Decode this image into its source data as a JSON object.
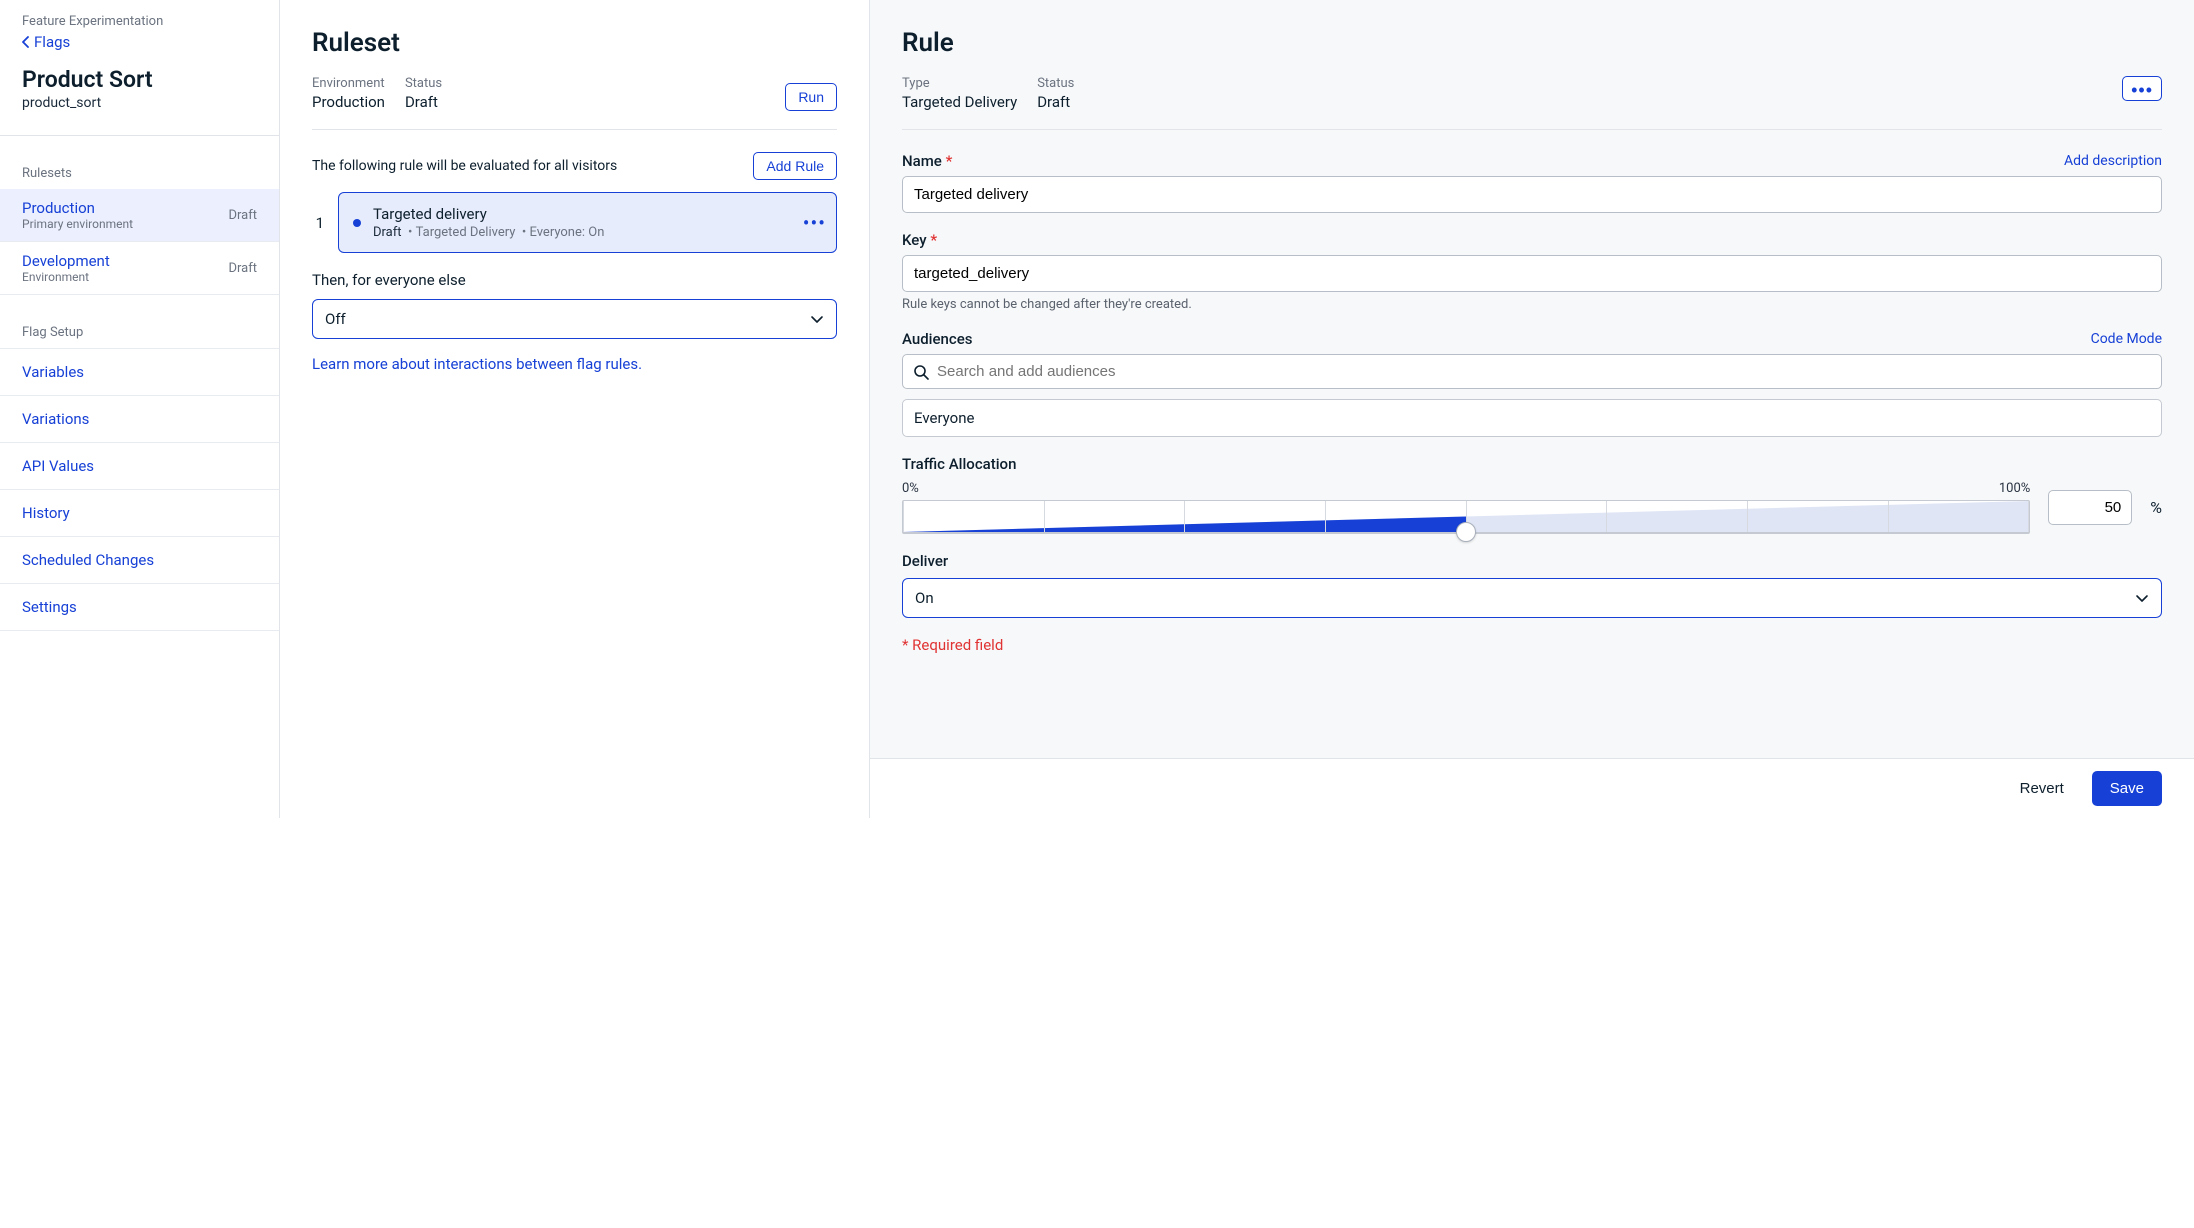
{
  "sidebar": {
    "subtitle": "Feature Experimentation",
    "back_label": "Flags",
    "flag_title": "Product Sort",
    "flag_key": "product_sort",
    "rulesets_label": "Rulesets",
    "flag_setup_label": "Flag Setup",
    "rulesets": [
      {
        "name": "Production",
        "desc": "Primary environment",
        "status": "Draft",
        "active": true
      },
      {
        "name": "Development",
        "desc": "Environment",
        "status": "Draft",
        "active": false
      }
    ],
    "setup_items": [
      "Variables",
      "Variations",
      "API Values",
      "History",
      "Scheduled Changes",
      "Settings"
    ]
  },
  "ruleset": {
    "heading": "Ruleset",
    "env_label": "Environment",
    "env_value": "Production",
    "status_label": "Status",
    "status_value": "Draft",
    "run_btn": "Run",
    "intro": "The following rule will be evaluated for all visitors",
    "add_rule_btn": "Add Rule",
    "rule_index": "1",
    "rule_card": {
      "title": "Targeted delivery",
      "status": "Draft",
      "type": "Targeted Delivery",
      "audience": "Everyone: On"
    },
    "else_label": "Then, for everyone else",
    "else_value": "Off",
    "learn_link": "Learn more about interactions between flag rules."
  },
  "rule": {
    "heading": "Rule",
    "type_label": "Type",
    "type_value": "Targeted Delivery",
    "status_label": "Status",
    "status_value": "Draft",
    "name_label": "Name",
    "add_desc_link": "Add description",
    "name_value": "Targeted delivery",
    "key_label": "Key",
    "key_value": "targeted_delivery",
    "key_help": "Rule keys cannot be changed after they're created.",
    "aud_label": "Audiences",
    "code_mode_link": "Code Mode",
    "aud_placeholder": "Search and add audiences",
    "aud_everyone": "Everyone",
    "traffic_label": "Traffic Allocation",
    "traffic_min": "0%",
    "traffic_max": "100%",
    "traffic_value": "50",
    "pct": "%",
    "deliver_label": "Deliver",
    "deliver_value": "On",
    "required_note": "* Required field",
    "revert_btn": "Revert",
    "save_btn": "Save"
  }
}
